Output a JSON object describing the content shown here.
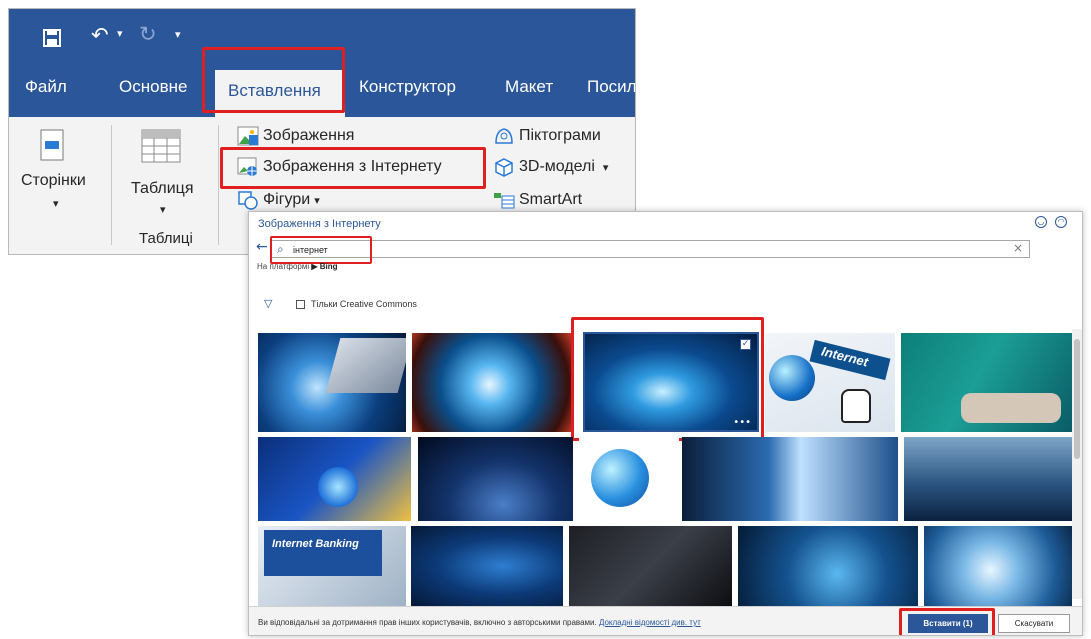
{
  "ribbon": {
    "tabs": [
      "Файл",
      "Основне",
      "Вставлення",
      "Конструктор",
      "Макет",
      "Посил"
    ],
    "active_tab": "Вставлення",
    "pages_label": "Сторінки",
    "table_label": "Таблиця",
    "tables_group_label": "Таблиці",
    "images_label": "Зображення",
    "online_images_label": "Зображення з Інтернету",
    "shapes_label": "Фігури",
    "icons_label": "Піктограми",
    "models3d_label": "3D-моделі",
    "smartart_label": "SmartArt",
    "dropdown_glyph": "▾",
    "accent": "#2b579a",
    "highlight": "#e02020"
  },
  "dialog": {
    "title": "Зображення з Інтернету",
    "search_value": "інтернет",
    "powered_by_prefix": "На платформі",
    "powered_by_brand": "Bing",
    "creative_commons_label": "Тільки Creative Commons",
    "thumb_texts": {
      "internet": "Internet",
      "banking": "Internet Banking"
    },
    "footer_text": "Ви відповідальні за дотримання прав інших користувачів, включно з авторськими правами.",
    "footer_link": "Докладні відомості див. тут",
    "insert_button": "Вставити (1)",
    "cancel_button": "Скасувати"
  }
}
